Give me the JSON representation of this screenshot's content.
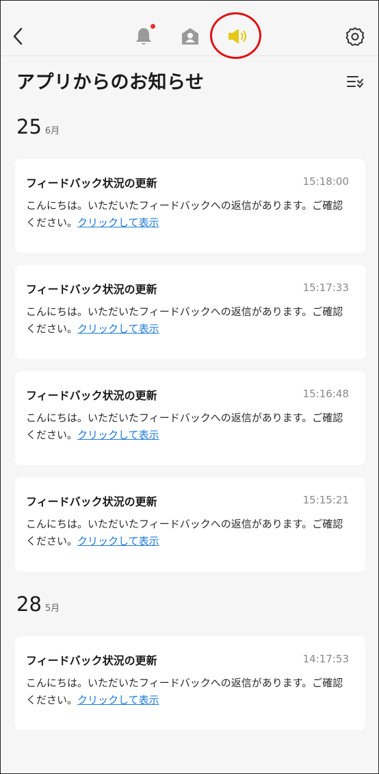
{
  "header": {
    "title": "アプリからのお知らせ",
    "icons": {
      "back": "back-chevron-icon",
      "notifications": "bell-icon",
      "profile": "person-icon",
      "announcements": "speaker-icon",
      "settings": "gear-icon",
      "filter": "filter-list-icon"
    },
    "notification_dot_color": "#ec2d2d",
    "active_tab_color": "#e4c919",
    "highlight_ring_color": "#e01010"
  },
  "groups": [
    {
      "day": "25",
      "month": "6月",
      "items": [
        {
          "title": "フィードバック状況の更新",
          "time": "15:18:00",
          "body": "こんにちは。いただいたフィードバックへの返信があります。ご確認ください。",
          "link": "クリックして表示"
        },
        {
          "title": "フィードバック状況の更新",
          "time": "15:17:33",
          "body": "こんにちは。いただいたフィードバックへの返信があります。ご確認ください。",
          "link": "クリックして表示"
        },
        {
          "title": "フィードバック状況の更新",
          "time": "15:16:48",
          "body": "こんにちは。いただいたフィードバックへの返信があります。ご確認ください。",
          "link": "クリックして表示"
        },
        {
          "title": "フィードバック状況の更新",
          "time": "15:15:21",
          "body": "こんにちは。いただいたフィードバックへの返信があります。ご確認ください。",
          "link": "クリックして表示"
        }
      ]
    },
    {
      "day": "28",
      "month": "5月",
      "items": [
        {
          "title": "フィードバック状況の更新",
          "time": "14:17:53",
          "body": "こんにちは。いただいたフィードバックへの返信があります。ご確認ください。",
          "link": "クリックして表示"
        }
      ]
    }
  ]
}
